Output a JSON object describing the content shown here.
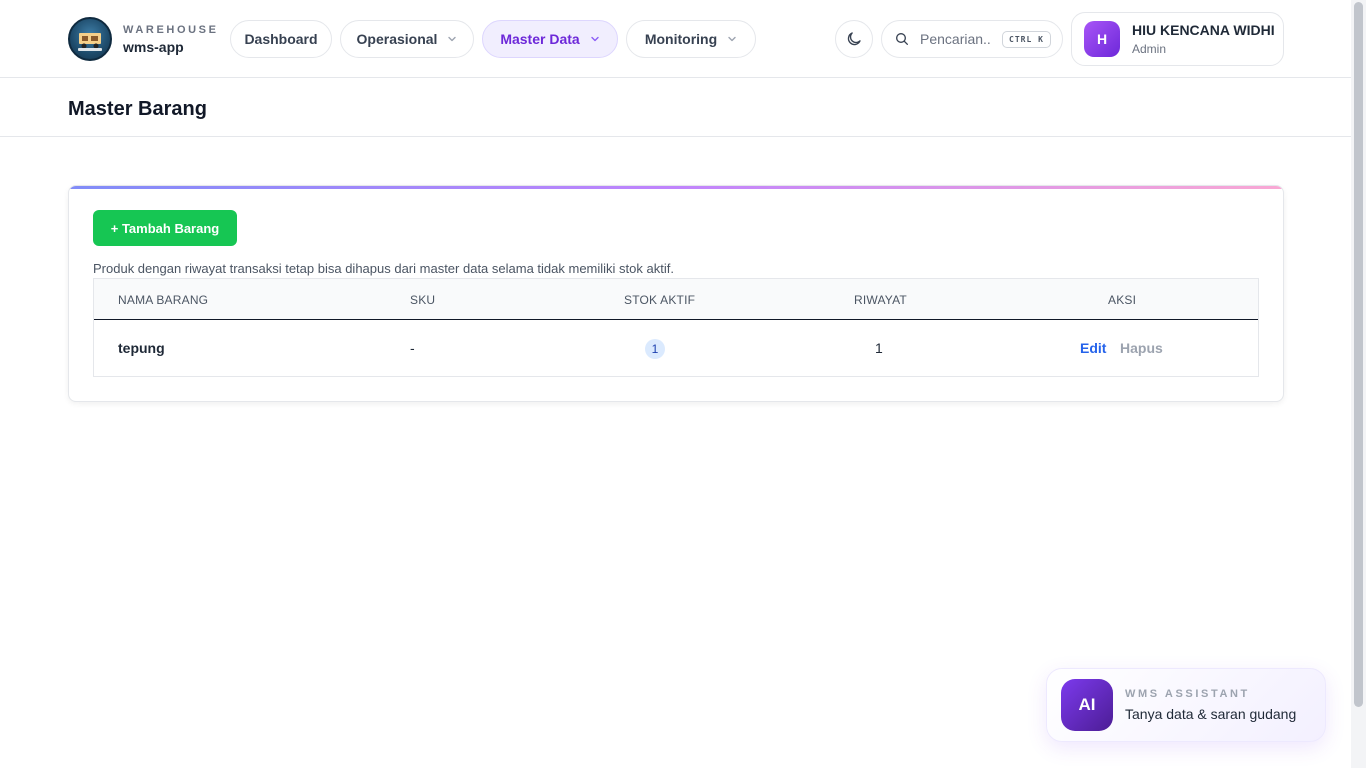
{
  "brand": {
    "kicker": "WAREHOUSE",
    "name": "wms-app"
  },
  "nav": [
    {
      "label": "Dashboard"
    },
    {
      "label": "Operasional"
    },
    {
      "label": "Master Data"
    },
    {
      "label": "Monitoring"
    }
  ],
  "search": {
    "placeholder": "Pencarian...",
    "shortcut": "CTRL K"
  },
  "user": {
    "initial": "H",
    "name": "HIU KENCANA WIDHI",
    "role": "Admin"
  },
  "page": {
    "title": "Master Barang"
  },
  "card": {
    "add_label": "+ Tambah Barang",
    "note": "Produk dengan riwayat transaksi tetap bisa dihapus dari master data selama tidak memiliki stok aktif."
  },
  "table": {
    "headers": [
      "NAMA BARANG",
      "SKU",
      "STOK AKTIF",
      "RIWAYAT",
      "AKSI"
    ],
    "rows": [
      {
        "name": "tepung",
        "sku": "-",
        "stock": "1",
        "history": "1",
        "edit": "Edit",
        "delete": "Hapus"
      }
    ]
  },
  "assistant": {
    "badge": "AI",
    "kicker": "WMS ASSISTANT",
    "subtitle": "Tanya data & saran gudang"
  },
  "colors": {
    "accent": "#6d28d9",
    "primary_button": "#16c653",
    "link": "#2563eb"
  }
}
